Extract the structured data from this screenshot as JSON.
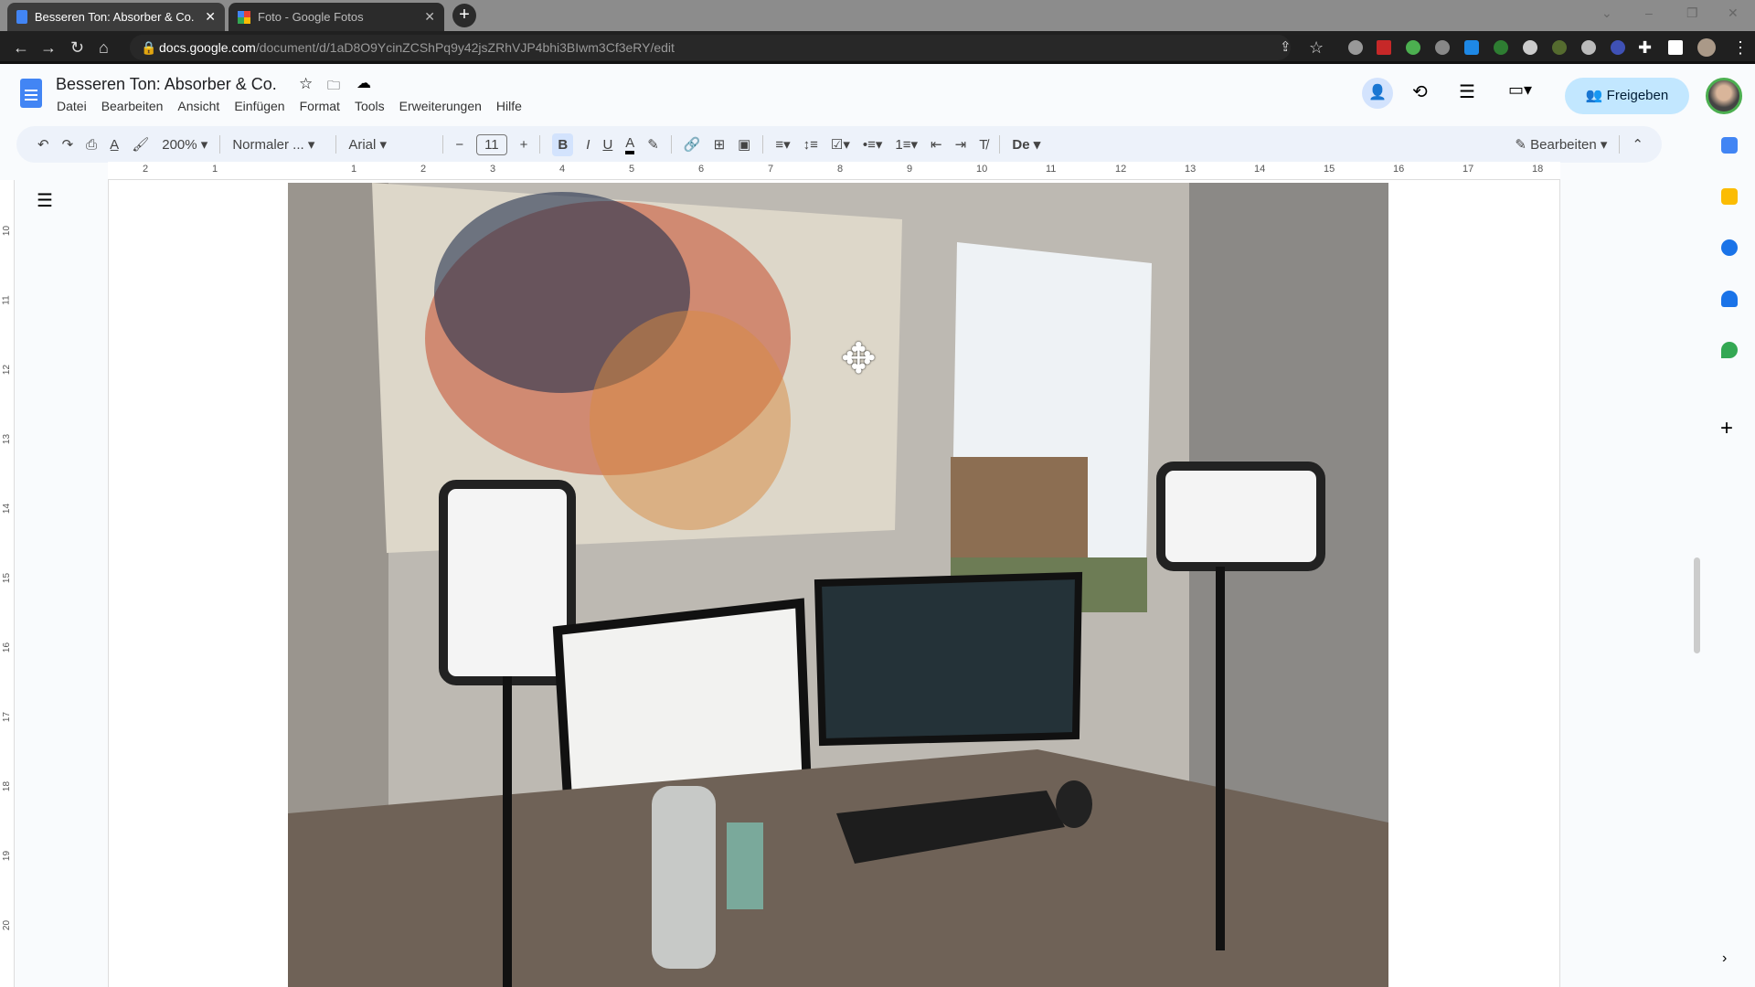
{
  "browser": {
    "tabs": [
      {
        "label": "Besseren Ton: Absorber & Co. - G",
        "active": true
      },
      {
        "label": "Foto - Google Fotos",
        "active": false
      }
    ],
    "url_domain": "docs.google.com",
    "url_path": "/document/d/1aD8O9YcinZCShPq9y42jsZRhVJP4bhi3BIwm3Cf3eRY/edit"
  },
  "doc": {
    "title": "Besseren Ton: Absorber & Co.",
    "menu": [
      "Datei",
      "Bearbeiten",
      "Ansicht",
      "Einfügen",
      "Format",
      "Tools",
      "Erweiterungen",
      "Hilfe"
    ],
    "share_label": "Freigeben"
  },
  "toolbar": {
    "zoom": "200%",
    "style": "Normaler ...",
    "font": "Arial",
    "font_size": "11",
    "bold": "B",
    "italic": "I",
    "underline": "U",
    "text_color": "A",
    "language": "De",
    "mode": "Bearbeiten"
  },
  "ruler": {
    "h": [
      "2",
      "1",
      "1",
      "2",
      "3",
      "4",
      "5",
      "6",
      "7",
      "8",
      "9",
      "10",
      "11",
      "12",
      "13",
      "14",
      "15",
      "16",
      "17",
      "18"
    ],
    "v": [
      "10",
      "11",
      "12",
      "13",
      "14",
      "15",
      "16",
      "17",
      "18",
      "19",
      "20"
    ]
  },
  "colors": {
    "accent": "#4285f4",
    "share_bg": "#c2e7ff",
    "toolbar_bg": "#edf2fa"
  }
}
